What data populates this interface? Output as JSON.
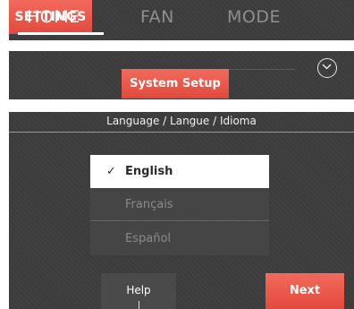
{
  "tabs": {
    "home": "HOME",
    "fan": "FAN",
    "mode": "MODE",
    "settings": "SETTINGS",
    "active": "home"
  },
  "menu": {
    "selected_item": "System Setup",
    "scroll_icon": "chevron-down-icon"
  },
  "dialog": {
    "title": "Language / Langue / Idioma",
    "options": [
      "English",
      "Français",
      "Español"
    ],
    "selected": "English",
    "check_mark": "✓",
    "help_label": "Help",
    "next_label": "Next"
  },
  "colors": {
    "accent": "#e8574a",
    "panel": "#3c3c3c",
    "selected_row": "#ffffff",
    "inactive_text": "#8a8a8a"
  }
}
